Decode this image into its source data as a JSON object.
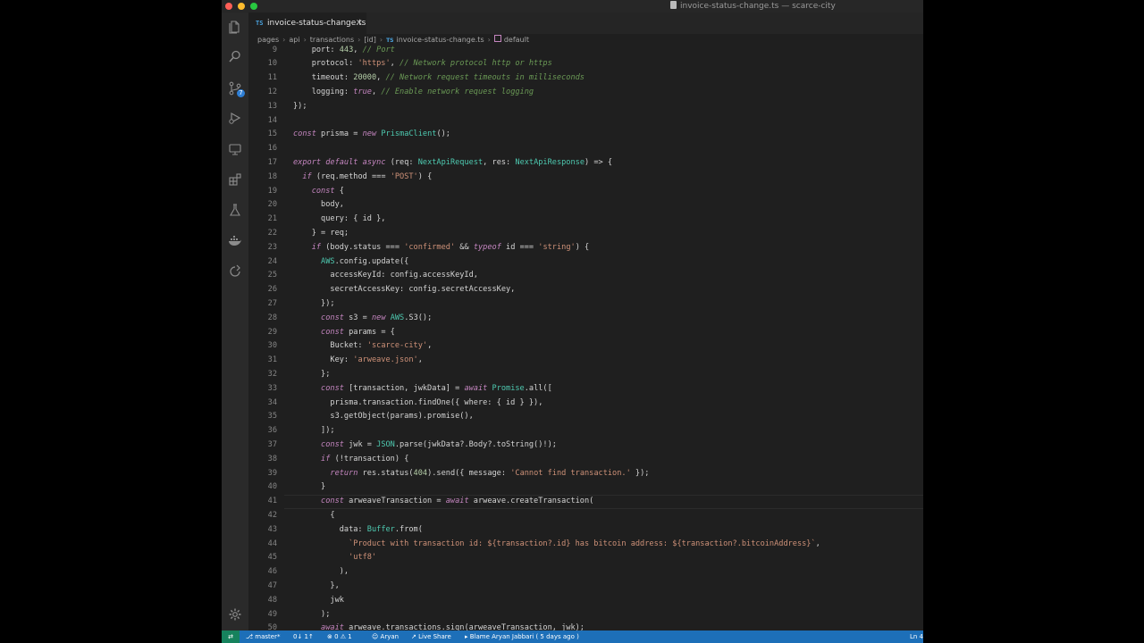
{
  "window": {
    "title": "invoice-status-change.ts — scarce-city"
  },
  "activity_bar": {
    "items": [
      {
        "name": "explorer",
        "icon": "files-icon"
      },
      {
        "name": "search",
        "icon": "search-icon"
      },
      {
        "name": "source-control",
        "icon": "source-control-icon",
        "badge": "7"
      },
      {
        "name": "run-debug",
        "icon": "run-debug-icon"
      },
      {
        "name": "remote-explorer",
        "icon": "remote-explorer-icon"
      },
      {
        "name": "extensions",
        "icon": "extensions-icon"
      },
      {
        "name": "testing",
        "icon": "flask-icon"
      },
      {
        "name": "docker",
        "icon": "docker-icon"
      },
      {
        "name": "live-share",
        "icon": "live-share-icon"
      },
      {
        "name": "settings",
        "icon": "gear-icon"
      }
    ]
  },
  "tab": {
    "label": "invoice-status-change.ts",
    "icon_text": "TS"
  },
  "breadcrumbs": {
    "items": [
      "pages",
      "api",
      "transactions",
      "[id]",
      "invoice-status-change.ts",
      "default"
    ]
  },
  "code_lines": [
    {
      "n": "9",
      "text": "    port: 443, // Port"
    },
    {
      "n": "10",
      "text": "    protocol: 'https', // Network protocol http or https"
    },
    {
      "n": "11",
      "text": "    timeout: 20000, // Network request timeouts in milliseconds"
    },
    {
      "n": "12",
      "text": "    logging: true, // Enable network request logging"
    },
    {
      "n": "13",
      "text": "});"
    },
    {
      "n": "14",
      "text": ""
    },
    {
      "n": "15",
      "text": "const prisma = new PrismaClient();"
    },
    {
      "n": "16",
      "text": ""
    },
    {
      "n": "17",
      "text": "export default async (req: NextApiRequest, res: NextApiResponse) => {"
    },
    {
      "n": "18",
      "text": "  if (req.method === 'POST') {"
    },
    {
      "n": "19",
      "text": "    const {"
    },
    {
      "n": "20",
      "text": "      body,"
    },
    {
      "n": "21",
      "text": "      query: { id },"
    },
    {
      "n": "22",
      "text": "    } = req;"
    },
    {
      "n": "23",
      "text": "    if (body.status === 'confirmed' && typeof id === 'string') {"
    },
    {
      "n": "24",
      "text": "      AWS.config.update({"
    },
    {
      "n": "25",
      "text": "        accessKeyId: config.accessKeyId,"
    },
    {
      "n": "26",
      "text": "        secretAccessKey: config.secretAccessKey,"
    },
    {
      "n": "27",
      "text": "      });"
    },
    {
      "n": "28",
      "text": "      const s3 = new AWS.S3();"
    },
    {
      "n": "29",
      "text": "      const params = {"
    },
    {
      "n": "30",
      "text": "        Bucket: 'scarce-city',"
    },
    {
      "n": "31",
      "text": "        Key: 'arweave.json',"
    },
    {
      "n": "32",
      "text": "      };"
    },
    {
      "n": "33",
      "text": "      const [transaction, jwkData] = await Promise.all(["
    },
    {
      "n": "34",
      "text": "        prisma.transaction.findOne({ where: { id } }),"
    },
    {
      "n": "35",
      "text": "        s3.getObject(params).promise(),"
    },
    {
      "n": "36",
      "text": "      ]);"
    },
    {
      "n": "37",
      "text": "      const jwk = JSON.parse(jwkData?.Body?.toString()!);"
    },
    {
      "n": "38",
      "text": "      if (!transaction) {"
    },
    {
      "n": "39",
      "text": "        return res.status(404).send({ message: 'Cannot find transaction.' });"
    },
    {
      "n": "40",
      "text": "      }"
    },
    {
      "n": "41",
      "text": "      const arweaveTransaction = await arweave.createTransaction("
    },
    {
      "n": "42",
      "text": "        {"
    },
    {
      "n": "43",
      "text": "          data: Buffer.from("
    },
    {
      "n": "44",
      "text": "            `Product with transaction id: ${transaction?.id} has bitcoin address: ${transaction?.bitcoinAddress}`,"
    },
    {
      "n": "45",
      "text": "            'utf8'"
    },
    {
      "n": "46",
      "text": "          ),"
    },
    {
      "n": "47",
      "text": "        },"
    },
    {
      "n": "48",
      "text": "        jwk"
    },
    {
      "n": "49",
      "text": "      );"
    },
    {
      "n": "50",
      "text": "      await arweave.transactions.sign(arweaveTransaction, jwk);"
    }
  ],
  "status_bar": {
    "branch": "master*",
    "sync": "0↓ 1↑",
    "problems": "⊗ 0 ⚠ 1",
    "user": "Aryan",
    "live_share": "Live Share",
    "blame": "Blame Aryan Jabbari ( 5 days ago )",
    "position": "Ln 4"
  },
  "colors": {
    "editor_bg": "#1f1f1f",
    "status_bar": "#1d6fb8",
    "remote": "#16825d",
    "keyword": "#c586c0",
    "string": "#ce9178",
    "comment": "#6a9955",
    "type": "#4ec9b0",
    "number": "#b5cea8"
  }
}
